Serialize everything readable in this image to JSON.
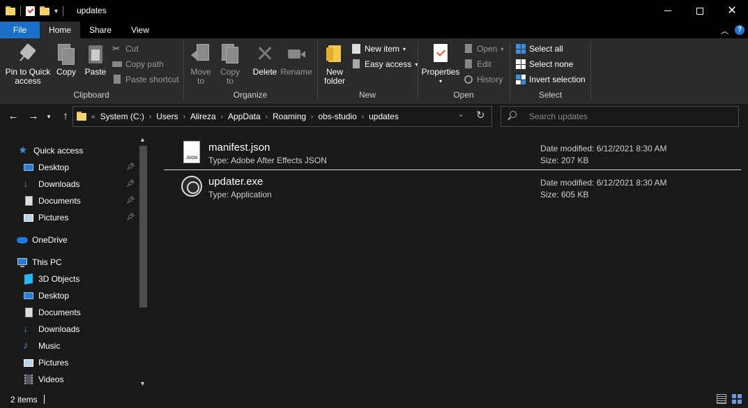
{
  "window": {
    "title": "updates"
  },
  "tabs": {
    "file": "File",
    "home": "Home",
    "share": "Share",
    "view": "View"
  },
  "ribbon": {
    "clipboard": {
      "label": "Clipboard",
      "pin": "Pin to Quick access",
      "copy": "Copy",
      "paste": "Paste",
      "cut": "Cut",
      "copy_path": "Copy path",
      "paste_shortcut": "Paste shortcut"
    },
    "organize": {
      "label": "Organize",
      "move_to": "Move to",
      "copy_to": "Copy to",
      "delete": "Delete",
      "rename": "Rename"
    },
    "new": {
      "label": "New",
      "new_folder": "New folder",
      "new_item": "New item",
      "easy_access": "Easy access"
    },
    "open": {
      "label": "Open",
      "properties": "Properties",
      "open": "Open",
      "edit": "Edit",
      "history": "History"
    },
    "select": {
      "label": "Select",
      "select_all": "Select all",
      "select_none": "Select none",
      "invert": "Invert selection"
    }
  },
  "address": {
    "overflow": "«",
    "crumbs": [
      "System (C:)",
      "Users",
      "Alireza",
      "AppData",
      "Roaming",
      "obs-studio",
      "updates"
    ]
  },
  "search": {
    "placeholder": "Search updates"
  },
  "nav": {
    "quick_access": "Quick access",
    "qa_items": [
      "Desktop",
      "Downloads",
      "Documents",
      "Pictures"
    ],
    "onedrive": "OneDrive",
    "this_pc": "This PC",
    "pc_items": [
      "3D Objects",
      "Desktop",
      "Documents",
      "Downloads",
      "Music",
      "Pictures",
      "Videos"
    ]
  },
  "files": [
    {
      "name": "manifest.json",
      "type": "Type: Adobe After Effects JSON",
      "modified": "Date modified: 6/12/2021 8:30 AM",
      "size": "Size: 207 KB",
      "icon_label": "JSON"
    },
    {
      "name": "updater.exe",
      "type": "Type: Application",
      "modified": "Date modified: 6/12/2021 8:30 AM",
      "size": "Size: 605 KB"
    }
  ],
  "status": {
    "count": "2 items"
  }
}
